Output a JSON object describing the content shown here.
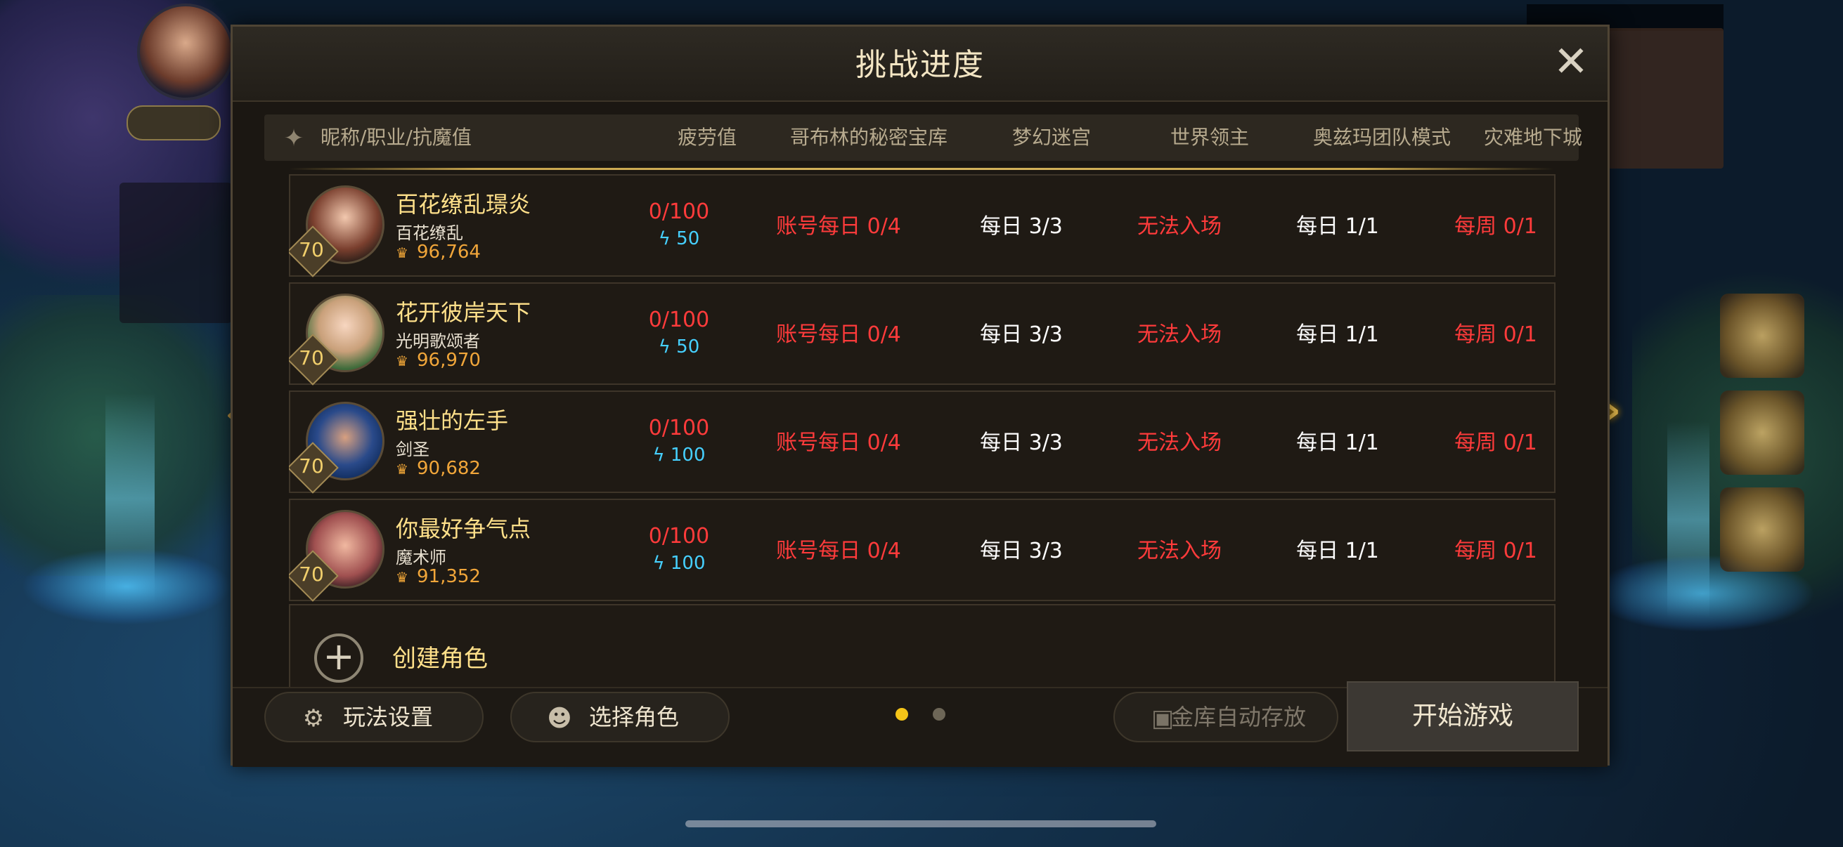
{
  "status_bar": {
    "text": ""
  },
  "top_badge": {
    "label": ""
  },
  "dialog": {
    "title": "挑战进度",
    "close_glyph": "✕"
  },
  "table": {
    "headers": [
      "昵称/职业/抗魔值",
      "疲劳值",
      "哥布林的秘密宝库",
      "梦幻迷宫",
      "世界领主",
      "奥兹玛团队模式",
      "灾难地下城"
    ],
    "rows": [
      {
        "level": "70",
        "name": "百花缭乱璟炎",
        "class": "百花缭乱",
        "power": "96,764",
        "fatigue": "0/100",
        "energy": "50",
        "goblin": "账号每日 0/4",
        "dream": "每日 3/3",
        "world": "无法入场",
        "ozma": "每日 1/1",
        "disaster": "每周 0/1"
      },
      {
        "level": "70",
        "name": "花开彼岸天下",
        "class": "光明歌颂者",
        "power": "96,970",
        "fatigue": "0/100",
        "energy": "50",
        "goblin": "账号每日 0/4",
        "dream": "每日 3/3",
        "world": "无法入场",
        "ozma": "每日 1/1",
        "disaster": "每周 0/1"
      },
      {
        "level": "70",
        "name": "强壮的左手",
        "class": "剑圣",
        "power": "90,682",
        "fatigue": "0/100",
        "energy": "100",
        "goblin": "账号每日 0/4",
        "dream": "每日 3/3",
        "world": "无法入场",
        "ozma": "每日 1/1",
        "disaster": "每周 0/1"
      },
      {
        "level": "70",
        "name": "你最好争气点",
        "class": "魔术师",
        "power": "91,352",
        "fatigue": "0/100",
        "energy": "100",
        "goblin": "账号每日 0/4",
        "dream": "每日 3/3",
        "world": "无法入场",
        "ozma": "每日 1/1",
        "disaster": "每周 0/1"
      }
    ],
    "create_label": "创建角色"
  },
  "footer": {
    "settings_label": "玩法设置",
    "select_role_label": "选择角色",
    "vault_label": "金库自动存放",
    "start_label": "开始游戏",
    "page_dots": {
      "active": 1,
      "total": 2
    }
  },
  "colors": {
    "red_status": "#ff3b3b",
    "gold_name": "#ffe08a",
    "energy_blue": "#46d0ff",
    "power_orange": "#f1a63a"
  },
  "icons": {
    "header": "wolf-head-icon",
    "settings": "gear-icon",
    "select_role": "person-swap-icon",
    "vault": "vault-icon",
    "create": "plus-icon",
    "close": "close-icon",
    "energy": "lightning-icon",
    "power": "crest-icon"
  }
}
